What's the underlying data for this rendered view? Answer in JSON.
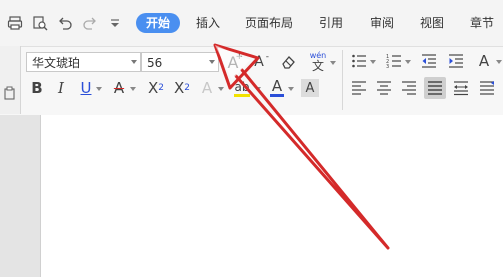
{
  "menu": {
    "tabs": [
      {
        "label": "开始",
        "active": true
      },
      {
        "label": "插入"
      },
      {
        "label": "页面布局"
      },
      {
        "label": "引用"
      },
      {
        "label": "审阅"
      },
      {
        "label": "视图"
      },
      {
        "label": "章节"
      }
    ]
  },
  "font": {
    "family_value": "华文琥珀",
    "size_value": "56"
  },
  "glyphs": {
    "bold": "B",
    "italic": "I",
    "underline": "U",
    "strike": "A",
    "superscript_base": "X",
    "superscript_exp": "2",
    "subscript_base": "X",
    "subscript_exp": "2",
    "effect": "A",
    "highlight": "ab",
    "font_color": "A",
    "char_shade": "A",
    "grow": "A",
    "shrink": "A",
    "phonetic_top": "wén",
    "phonetic_bottom": "文",
    "more_a": "A"
  },
  "colors": {
    "accent": "#4a8ff0",
    "arrow": "#d42a2a",
    "font_color_bar": "#2b4fd8",
    "highlight_bar": "#f2e200",
    "strike_color": "#d42a2a"
  },
  "icons": [
    "print-icon",
    "print-preview-icon",
    "undo-icon",
    "redo-icon",
    "customize-dropdown-icon",
    "eraser-icon",
    "bullet-list-icon",
    "numbered-list-icon",
    "decrease-indent-icon",
    "increase-indent-icon",
    "align-left-icon",
    "align-center-icon",
    "align-right-icon",
    "justify-icon",
    "distributed-icon",
    "paragraph-icon"
  ]
}
